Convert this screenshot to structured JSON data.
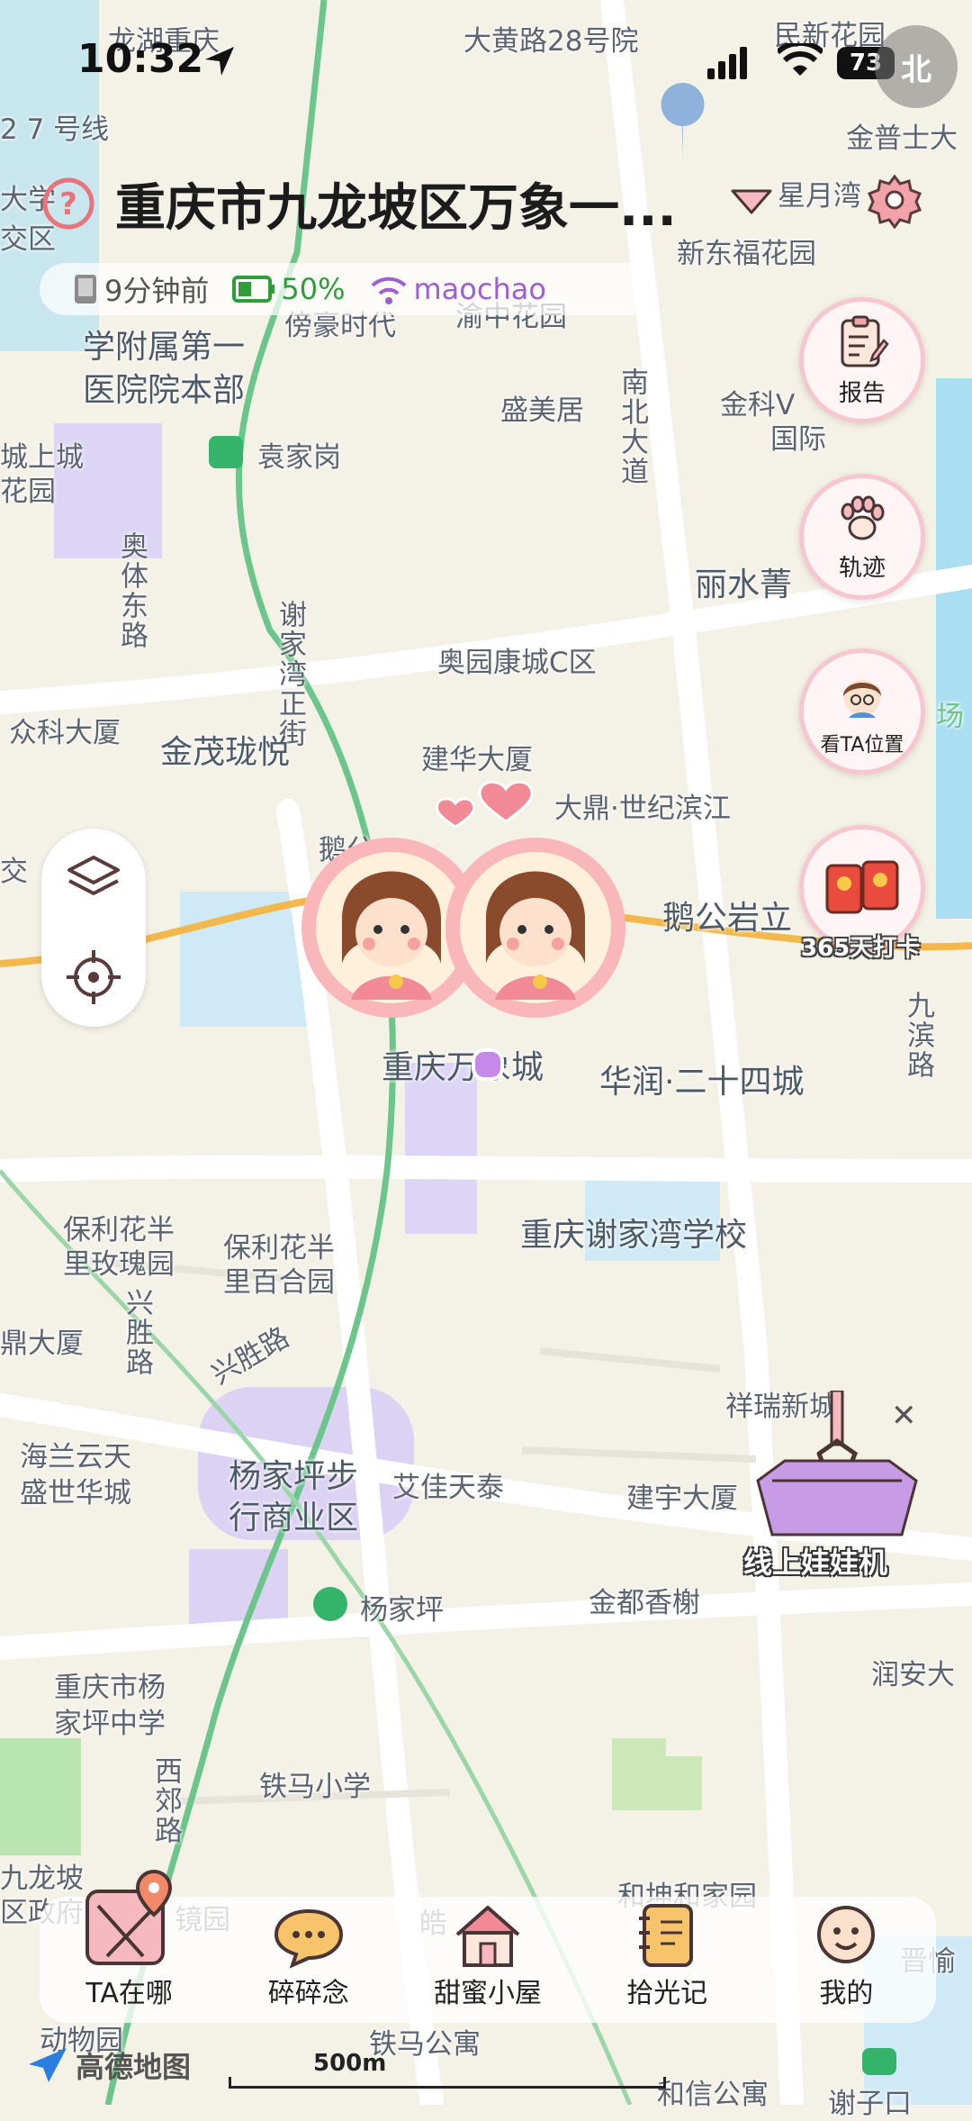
{
  "status_bar": {
    "time": "10:32",
    "battery": "73"
  },
  "compass": {
    "label": "北"
  },
  "header": {
    "address": "重庆市九龙坡区万象一...",
    "info": {
      "time_ago": "9分钟前",
      "battery": "50%",
      "wifi": "maochao"
    }
  },
  "colors": {
    "accent_pink": "#f7c7d0",
    "route_green": "#6cc58a",
    "road_orange": "#f2b84b",
    "battery_green": "#2e9d3a",
    "wifi_purple": "#9d5fd1"
  },
  "right_actions": [
    {
      "label": "报告",
      "icon": "clipboard-icon"
    },
    {
      "label": "轨迹",
      "icon": "paw-icon"
    },
    {
      "label": "看TA位置",
      "icon": "boy-avatar-icon"
    },
    {
      "label": "365天打卡",
      "icon": "red-envelope-icon"
    }
  ],
  "claw_machine": {
    "label": "线上娃娃机"
  },
  "map_labels": {
    "l1": "龙湖重庆",
    "l2": "大黄路28号院",
    "l3": "民新花园",
    "l4": "金普士大",
    "l5": "星月湾",
    "l6": "新东福花园",
    "l7": "渝中花园",
    "l8": "学附属第一",
    "l9": "医院院本部",
    "l10": "傍豪时代",
    "l11": "袁家岗",
    "l12": "盛美居",
    "l13": "金科V",
    "l14": "国际",
    "l15": "南北大道",
    "l16": "丽水菁",
    "l17": "城上城",
    "l18": "花园",
    "l19": "奥体东路",
    "l20": "谢家湾正街",
    "l21": "奥园康城C区",
    "l22": "众科大厦",
    "l23": "金茂珑悦",
    "l24": "建华大厦",
    "l25": "大鼎·世纪滨江",
    "l26": "鹅公岩立",
    "l27": "重庆万象城",
    "l28": "华润·二十四城",
    "l29": "保利花半",
    "l30": "里玫瑰园",
    "l31": "保利花半",
    "l32": "里百合园",
    "l33": "重庆谢家湾学校",
    "l34": "兴胜路",
    "l35": "兴胜路",
    "l36": "鼎大厦",
    "l37": "祥瑞新城",
    "l38": "海兰云天",
    "l39": "盛世华城",
    "l40": "杨家坪步",
    "l41": "行商业区",
    "l42": "艾佳天泰",
    "l43": "建宇大厦",
    "l44": "金都香榭",
    "l45": "杨家坪",
    "l46": "润安大",
    "l47": "重庆市杨",
    "l48": "家坪中学",
    "l49": "铁马小学",
    "l50": "西郊路",
    "l51": "九龙坡",
    "l52": "区政府",
    "l53": "和坤和家园",
    "l54": "动物园",
    "l55": "铁马公寓",
    "l56": "和信公寓",
    "l57": "2 7 号线",
    "l58": "九滨路",
    "l59": "大学",
    "l60": "交区",
    "l61": "鹅公",
    "l62": "交",
    "l63": "场",
    "l64": "晋愉",
    "l65": "谢子口",
    "l66": "镜园",
    "l67": "皓"
  },
  "map_attribution": {
    "brand": "高德地图",
    "scale": "500m"
  },
  "tabs": [
    {
      "label": "TA在哪",
      "icon": "map-pin-icon"
    },
    {
      "label": "碎碎念",
      "icon": "chat-bubble-icon"
    },
    {
      "label": "甜蜜小屋",
      "icon": "house-icon"
    },
    {
      "label": "拾光记",
      "icon": "notebook-icon"
    },
    {
      "label": "我的",
      "icon": "smiley-icon"
    }
  ]
}
